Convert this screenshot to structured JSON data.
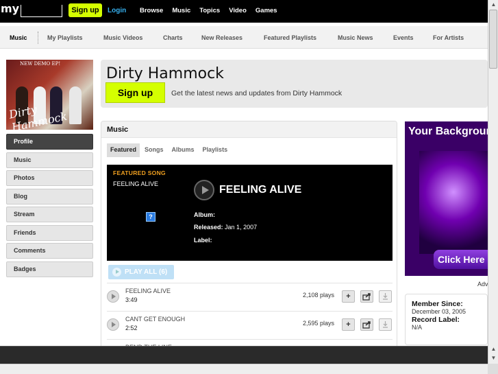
{
  "topbar": {
    "logo": "my",
    "signup": "Sign up",
    "login": "Login",
    "nav": [
      "Browse",
      "Music",
      "Topics",
      "Video",
      "Games"
    ]
  },
  "subnav": {
    "items": [
      "Music",
      "My Playlists",
      "Music Videos",
      "Charts",
      "New Releases",
      "Featured Playlists",
      "Music News",
      "Events",
      "For Artists"
    ]
  },
  "profile": {
    "image_text_demo": "NEW DEMO EP!",
    "image_text_band": "Dirty Hammock",
    "menu": [
      "Profile",
      "Music",
      "Photos",
      "Blog",
      "Stream",
      "Friends",
      "Comments",
      "Badges"
    ]
  },
  "header": {
    "band_name": "Dirty Hammock",
    "signup": "Sign up",
    "description": "Get the latest news and updates from Dirty Hammock"
  },
  "music": {
    "title": "Music",
    "tabs": [
      "Featured",
      "Songs",
      "Albums",
      "Playlists"
    ],
    "featured": {
      "label": "FEATURED SONG",
      "song": "FEELING ALIVE",
      "title": "FEELING ALIVE",
      "album_label": "Album:",
      "album_value": "",
      "released_label": "Released:",
      "released_value": "Jan 1, 2007",
      "label_label": "Label:",
      "label_value": "",
      "missing_image": "?"
    },
    "play_all": "PLAY ALL (6)",
    "songs": [
      {
        "name": "FEELING ALIVE",
        "duration": "3:49",
        "plays": "2,108 plays"
      },
      {
        "name": "CANT GET ENOUGH",
        "duration": "2:52",
        "plays": "2,595 plays"
      },
      {
        "name": "BEND THE LINE",
        "duration": "",
        "plays": ""
      }
    ],
    "icons": {
      "add": "+",
      "share": "share-icon",
      "download": "download-icon"
    }
  },
  "ad": {
    "title": "Your Background",
    "cta": "Click Here",
    "label": "Adv"
  },
  "member": {
    "since_label": "Member Since:",
    "since_value": "December 03, 2005",
    "record_label": "Record Label:",
    "record_value": "N/A"
  },
  "colors": {
    "accent": "#d4ff00",
    "link": "#37b1f0",
    "featured_label": "#f0a020"
  }
}
